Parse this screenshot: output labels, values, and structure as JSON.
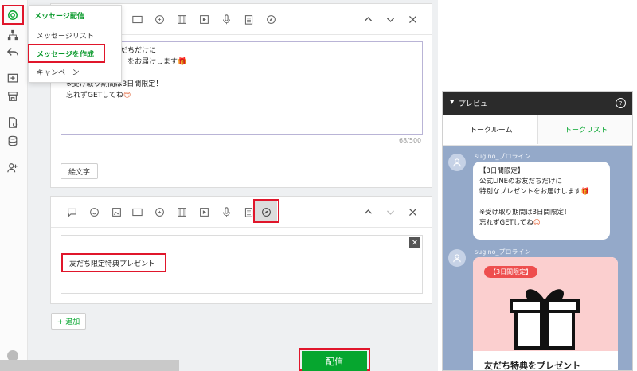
{
  "menu": {
    "header": "メッセージ配信",
    "items": [
      "メッセージリスト",
      "メッセージを作成",
      "キャンペーン"
    ]
  },
  "message1": {
    "text_lines": [
      "だちだけに",
      "ーをお届けします",
      "",
      "※受け取り期間は3日間限定！",
      "忘れずGETしてね"
    ],
    "counter": "68/500",
    "emoji_button": "絵文字"
  },
  "message2": {
    "title_value": "友だち限定特典プレゼント"
  },
  "add_button": "+ 追加",
  "send_button": "配信",
  "preview": {
    "header": "プレビュー",
    "help_icon": "?",
    "tabs": [
      "トークルーム",
      "トークリスト"
    ],
    "sender": "sugino_プロライン",
    "bubble_lines": [
      "【3日間限定】",
      "公式LINEのお友だちだけに",
      "特別なプレゼントをお届けします",
      "",
      "※受け取り期間は3日間限定！",
      "忘れずGETしてね"
    ],
    "card_badge": "【3日間限定】",
    "card_title": "友だち特典をプレゼント"
  },
  "colors": {
    "accent_green": "#06a62f",
    "highlight_red": "#e0162b",
    "preview_header": "#2b2b2b",
    "chat_bg": "#94a9c9",
    "card_pink": "#fbcfcf"
  }
}
